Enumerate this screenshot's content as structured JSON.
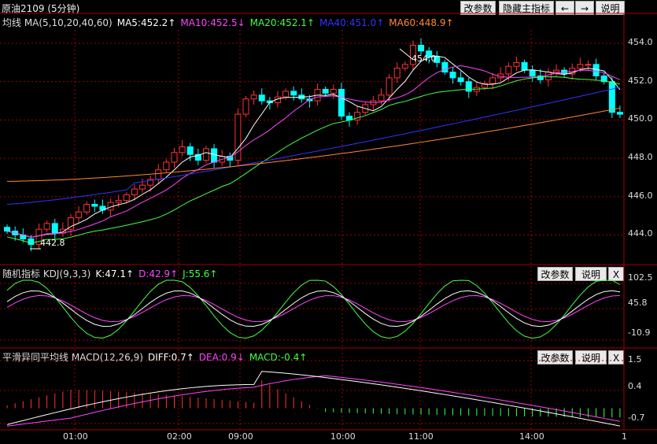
{
  "window": {
    "title": "原油2109 (5分钟)"
  },
  "toolbar": {
    "buttons": [
      "改参数",
      "隐藏主指标",
      "←",
      "→",
      "说明"
    ]
  },
  "main": {
    "header": [
      {
        "text": "均线  MA(5,10,20,40,60)",
        "color": "#dddddd"
      },
      {
        "text": "MA5:452.2↑",
        "color": "#ffffff"
      },
      {
        "text": "MA10:452.5↓",
        "color": "#ff44ff"
      },
      {
        "text": "MA20:452.1↑",
        "color": "#44ff44"
      },
      {
        "text": "MA40:451.0↑",
        "color": "#3333ff"
      },
      {
        "text": "MA60:448.9↑",
        "color": "#ff8833"
      }
    ],
    "price_ticks": [
      "454.0",
      "452.0",
      "450.0",
      "448.0",
      "446.0",
      "444.0"
    ],
    "annotations": {
      "high": "454.0",
      "low": "442.8"
    }
  },
  "kdj": {
    "header": [
      {
        "text": "随机指标  KDJ(9,3,3)",
        "color": "#dddddd"
      },
      {
        "text": "K:47.1↑",
        "color": "#ffffff"
      },
      {
        "text": "D:42.9↑",
        "color": "#ff44ff"
      },
      {
        "text": "J:55.6↑",
        "color": "#44ff44"
      }
    ],
    "buttons": [
      "改参数",
      "说明",
      "X"
    ],
    "ticks": [
      "102.5",
      "45.8",
      "-10.9"
    ]
  },
  "macd": {
    "header": [
      {
        "text": "平滑异同平均线  MACD(12,26,9)",
        "color": "#dddddd"
      },
      {
        "text": "DIFF:0.7↑",
        "color": "#ffffff"
      },
      {
        "text": "DEA:0.9↓",
        "color": "#ff44ff"
      },
      {
        "text": "MACD:-0.4↑",
        "color": "#44ff44"
      }
    ],
    "buttons": [
      "改参数",
      "说明",
      "X"
    ],
    "ticks": [
      "1.5",
      "0.4",
      "-0.7"
    ]
  },
  "time_axis": [
    "01:00",
    "02:00",
    "09:00",
    "10:00",
    "11:00",
    "14:00",
    "1"
  ],
  "colors": {
    "up": "#ff3333",
    "down": "#00ffff",
    "ma5": "#ffffff",
    "ma10": "#ff44ff",
    "ma20": "#44ff44",
    "ma40": "#3333ff",
    "ma60": "#ff8833",
    "grid": "#a00000"
  },
  "chart_data": {
    "type": "candlestick",
    "ylim": [
      442.5,
      454.7
    ],
    "candles_close": [
      444.2,
      444.0,
      443.8,
      443.5,
      444.3,
      444.6,
      444.1,
      444.3,
      444.9,
      445.2,
      445.6,
      445.5,
      445.3,
      445.7,
      445.8,
      446.1,
      446.4,
      446.6,
      446.9,
      447.4,
      447.8,
      448.3,
      448.6,
      448.2,
      447.9,
      448.5,
      447.8,
      448.1,
      447.9,
      450.3,
      451.1,
      451.3,
      451.0,
      450.9,
      451.2,
      451.5,
      451.3,
      451.1,
      451.0,
      451.6,
      451.4,
      451.6,
      450.2,
      450.0,
      450.4,
      450.8,
      451.0,
      451.3,
      452.2,
      452.7,
      452.9,
      453.9,
      453.6,
      453.3,
      453.0,
      452.5,
      452.2,
      452.0,
      451.5,
      451.7,
      451.9,
      452.2,
      452.4,
      452.8,
      453.0,
      452.6,
      452.3,
      452.1,
      452.5,
      452.6,
      452.4,
      452.7,
      452.9,
      452.9,
      452.3,
      452.0,
      450.4,
      450.3
    ],
    "kdj_range": [
      -10.9,
      102.5
    ],
    "macd_range": [
      -0.7,
      1.5
    ]
  }
}
